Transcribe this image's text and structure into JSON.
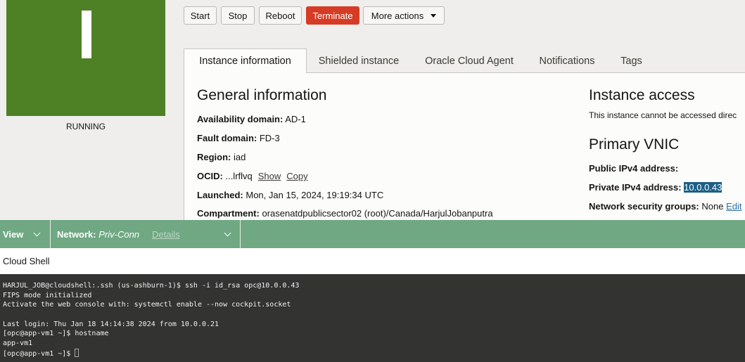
{
  "instance": {
    "letter": "I",
    "state": "RUNNING",
    "tile_color": "#4e8126"
  },
  "actions": {
    "start": "Start",
    "stop": "Stop",
    "reboot": "Reboot",
    "terminate": "Terminate",
    "more": "More actions"
  },
  "tabs": [
    "Instance information",
    "Shielded instance",
    "Oracle Cloud Agent",
    "Notifications",
    "Tags"
  ],
  "general": {
    "title": "General information",
    "availability_label": "Availability domain:",
    "availability": "AD-1",
    "fault_label": "Fault domain:",
    "fault": "FD-3",
    "region_label": "Region:",
    "region": "iad",
    "ocid_label": "OCID:",
    "ocid": "...lrflvq",
    "show": "Show",
    "copy": "Copy",
    "launched_label": "Launched:",
    "launched": "Mon, Jan 15, 2024, 19:19:34 UTC",
    "compartment_label": "Compartment:",
    "compartment": "orasenatdpublicsector02 (root)/Canada/HarjulJobanputra"
  },
  "access": {
    "title": "Instance access",
    "text": "This instance cannot be accessed direc"
  },
  "vnic": {
    "title": "Primary VNIC",
    "public_label": "Public IPv4 address:",
    "public": "",
    "private_label": "Private IPv4 address:",
    "private": "10.0.0.43",
    "nsg_label": "Network security groups:",
    "nsg": "None",
    "edit": "Edit"
  },
  "shellbar": {
    "view": "View",
    "network_label": "Network:",
    "network": "Priv-Conn",
    "details": "Details"
  },
  "cloudshell": {
    "title": "Cloud Shell"
  },
  "terminal": {
    "lines": [
      "HARJUL_JOB@cloudshell:.ssh (us-ashburn-1)$ ssh -i id_rsa opc@10.0.0.43",
      "FIPS mode initialized",
      "Activate the web console with: systemctl enable --now cockpit.socket",
      "",
      "Last login: Thu Jan 18 14:14:38 2024 from 10.0.0.21",
      "[opc@app-vm1 ~]$ hostname",
      "app-vm1"
    ],
    "prompt": "[opc@app-vm1 ~]$ "
  }
}
